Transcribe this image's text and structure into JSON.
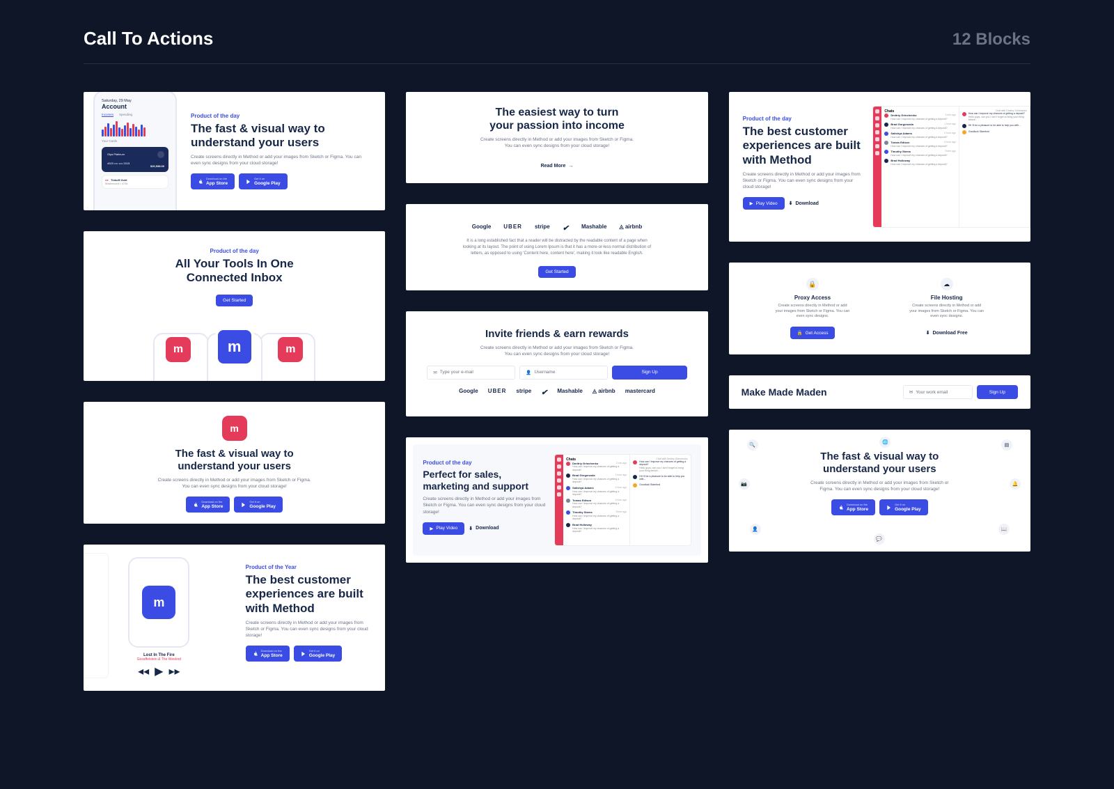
{
  "header": {
    "title": "Call To Actions",
    "count": "12 Blocks"
  },
  "eyebrows": {
    "day": "Product of the day",
    "year": "Product of the Year"
  },
  "titles": {
    "fast_visual": "The fast & visual way to understand your users",
    "tools_inbox": "All Your Tools In One Connected Inbox",
    "best_customer": "The best customer experiences are built with Method",
    "passion_income": "The easiest way to turn your passion into income",
    "invite_friends": "Invite friends & earn rewards",
    "perfect_sales": "Perfect for sales, marketing and support",
    "make_made": "Make Made Maden"
  },
  "descs": {
    "create_screens": "Create screens directly in Method or add your images from Sketch or Figma. You can even sync designs from your cloud storage!",
    "create_short": "Create screens directly in Method or add your images from Sketch or Figma. You can even sync designs.",
    "lorem_long": "It is a long established fact that a reader will be distracted by the readable content of a page when looking at its layout. The point of using Lorem Ipsum is that it has a more-or-less normal distribution of letters, as opposed to using 'Content here, content here', making it look like readable English."
  },
  "buttons": {
    "app_store": "App Store",
    "app_store_sub": "Download on the",
    "google_play": "Google Play",
    "google_play_sub": "Get it on",
    "get_started": "Get Started",
    "read_more": "Read More",
    "sign_up": "Sign Up",
    "play_video": "Play Video",
    "download": "Download",
    "get_access": "Get Access",
    "download_free": "Download Free"
  },
  "inputs": {
    "email": "Type your e-mail",
    "username": "Username",
    "work_email": "Your work email"
  },
  "logos": [
    "Google",
    "UBER",
    "stripe",
    "Nike",
    "Mashable",
    "airbnb",
    "mastercard"
  ],
  "feature_cards": {
    "proxy": {
      "title": "Proxy Access"
    },
    "file": {
      "title": "File Hosting"
    }
  },
  "phone": {
    "date": "Saturday, 29 May",
    "title": "Account",
    "tabs": [
      "Incomes",
      "Spending"
    ],
    "cards_label": "Your Cards",
    "card_name": "Olya Platinum",
    "card_num": "4923 •••• •••• 2015",
    "card_bal": "$10,938.00",
    "card2_name": "Tinkoff Gold",
    "card2_sub": "Mastercard • 4736"
  },
  "music": {
    "track": "Lost In The Fire",
    "artist": "Gesaffelstein & The Weeknd"
  },
  "chat": {
    "header": "Chats",
    "conv_header": "Chat with Dmitriy Grinchenko",
    "items": [
      {
        "name": "Dmitriy Grinchenko",
        "msg": "How can I improve my chances of getting a deposit?",
        "time": "3 min ago",
        "color": "#e43b5a"
      },
      {
        "name": "Brad Gorgonzola",
        "msg": "How can I improve my chances of getting a deposit?",
        "time": "1 hour ago",
        "color": "#172748"
      },
      {
        "name": "Salishya Adams",
        "msg": "How can I improve my chances of getting a deposit?",
        "time": "2 hour ago",
        "color": "#3b4ce4"
      },
      {
        "name": "Tomas Edison",
        "msg": "How can I improve my chances of getting a deposit?",
        "time": "3 hour ago",
        "color": "#7b8499"
      },
      {
        "name": "Timothy Stems",
        "msg": "How can I improve my chances of getting a deposit?",
        "time": "Three ago",
        "color": "#3b4ce4"
      },
      {
        "name": "Brad Holloway",
        "msg": "How can I improve my chances of getting a deposit?",
        "time": "",
        "color": "#172748"
      }
    ],
    "msgs": [
      {
        "text": "How can I improve my chances of getting a deposit?",
        "sub": "Hello guys, can you I don't forget to bring your thing before...",
        "color": "#e43b5a"
      },
      {
        "text": "Hi! I'll be a pleasure to be able to help you with...",
        "color": "#172748"
      },
      {
        "text": "Goodluck Stamford",
        "color": "#f5a623"
      }
    ]
  }
}
